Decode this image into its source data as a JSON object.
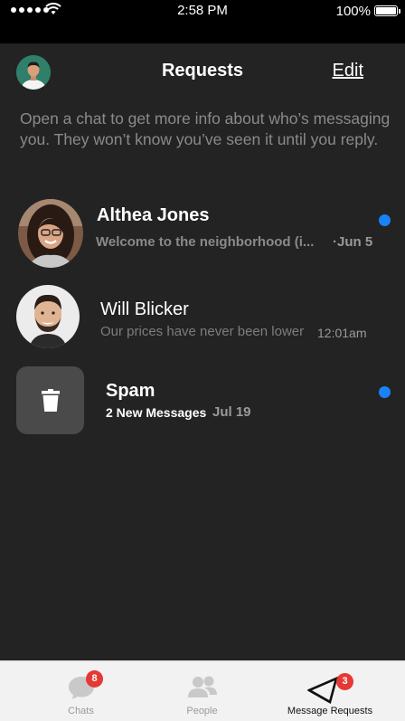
{
  "status_bar": {
    "time": "2:58 PM",
    "battery": "100%",
    "signal_icon": "signal-dots-icon",
    "wifi_icon": "wifi-icon",
    "battery_icon": "battery-icon"
  },
  "header": {
    "title": "Requests",
    "edit_label": "Edit",
    "avatar_icon": "profile-avatar"
  },
  "info_text": "Open a chat to get more info about who’s messaging you. They won’t know you’ve seen it until you reply.",
  "requests": [
    {
      "name": "Althea Jones",
      "preview": "Welcome to the neighborhood (i...",
      "date": "·Jun 5",
      "unread": true,
      "avatar_icon": "althea-avatar"
    },
    {
      "name": "Will Blicker",
      "preview": "Our prices have never been lower",
      "date": "12:01am",
      "unread": false,
      "avatar_icon": "will-avatar"
    }
  ],
  "spam": {
    "name": "Spam",
    "subtitle": "2 New Messages",
    "date": "Jul 19",
    "unread": true,
    "icon": "trash-icon"
  },
  "tabs": [
    {
      "label": "Chats",
      "badge": "8",
      "icon": "chat-bubble-icon",
      "active": false
    },
    {
      "label": "People",
      "badge": "",
      "icon": "people-icon",
      "active": false
    },
    {
      "label": "Message Requests",
      "badge": "3",
      "icon": "send-arrow-icon",
      "active": true
    }
  ],
  "colors": {
    "background": "#232323",
    "unread_dot": "#1a82f7",
    "badge": "#e53935",
    "tabbar": "#f2f2f2"
  }
}
